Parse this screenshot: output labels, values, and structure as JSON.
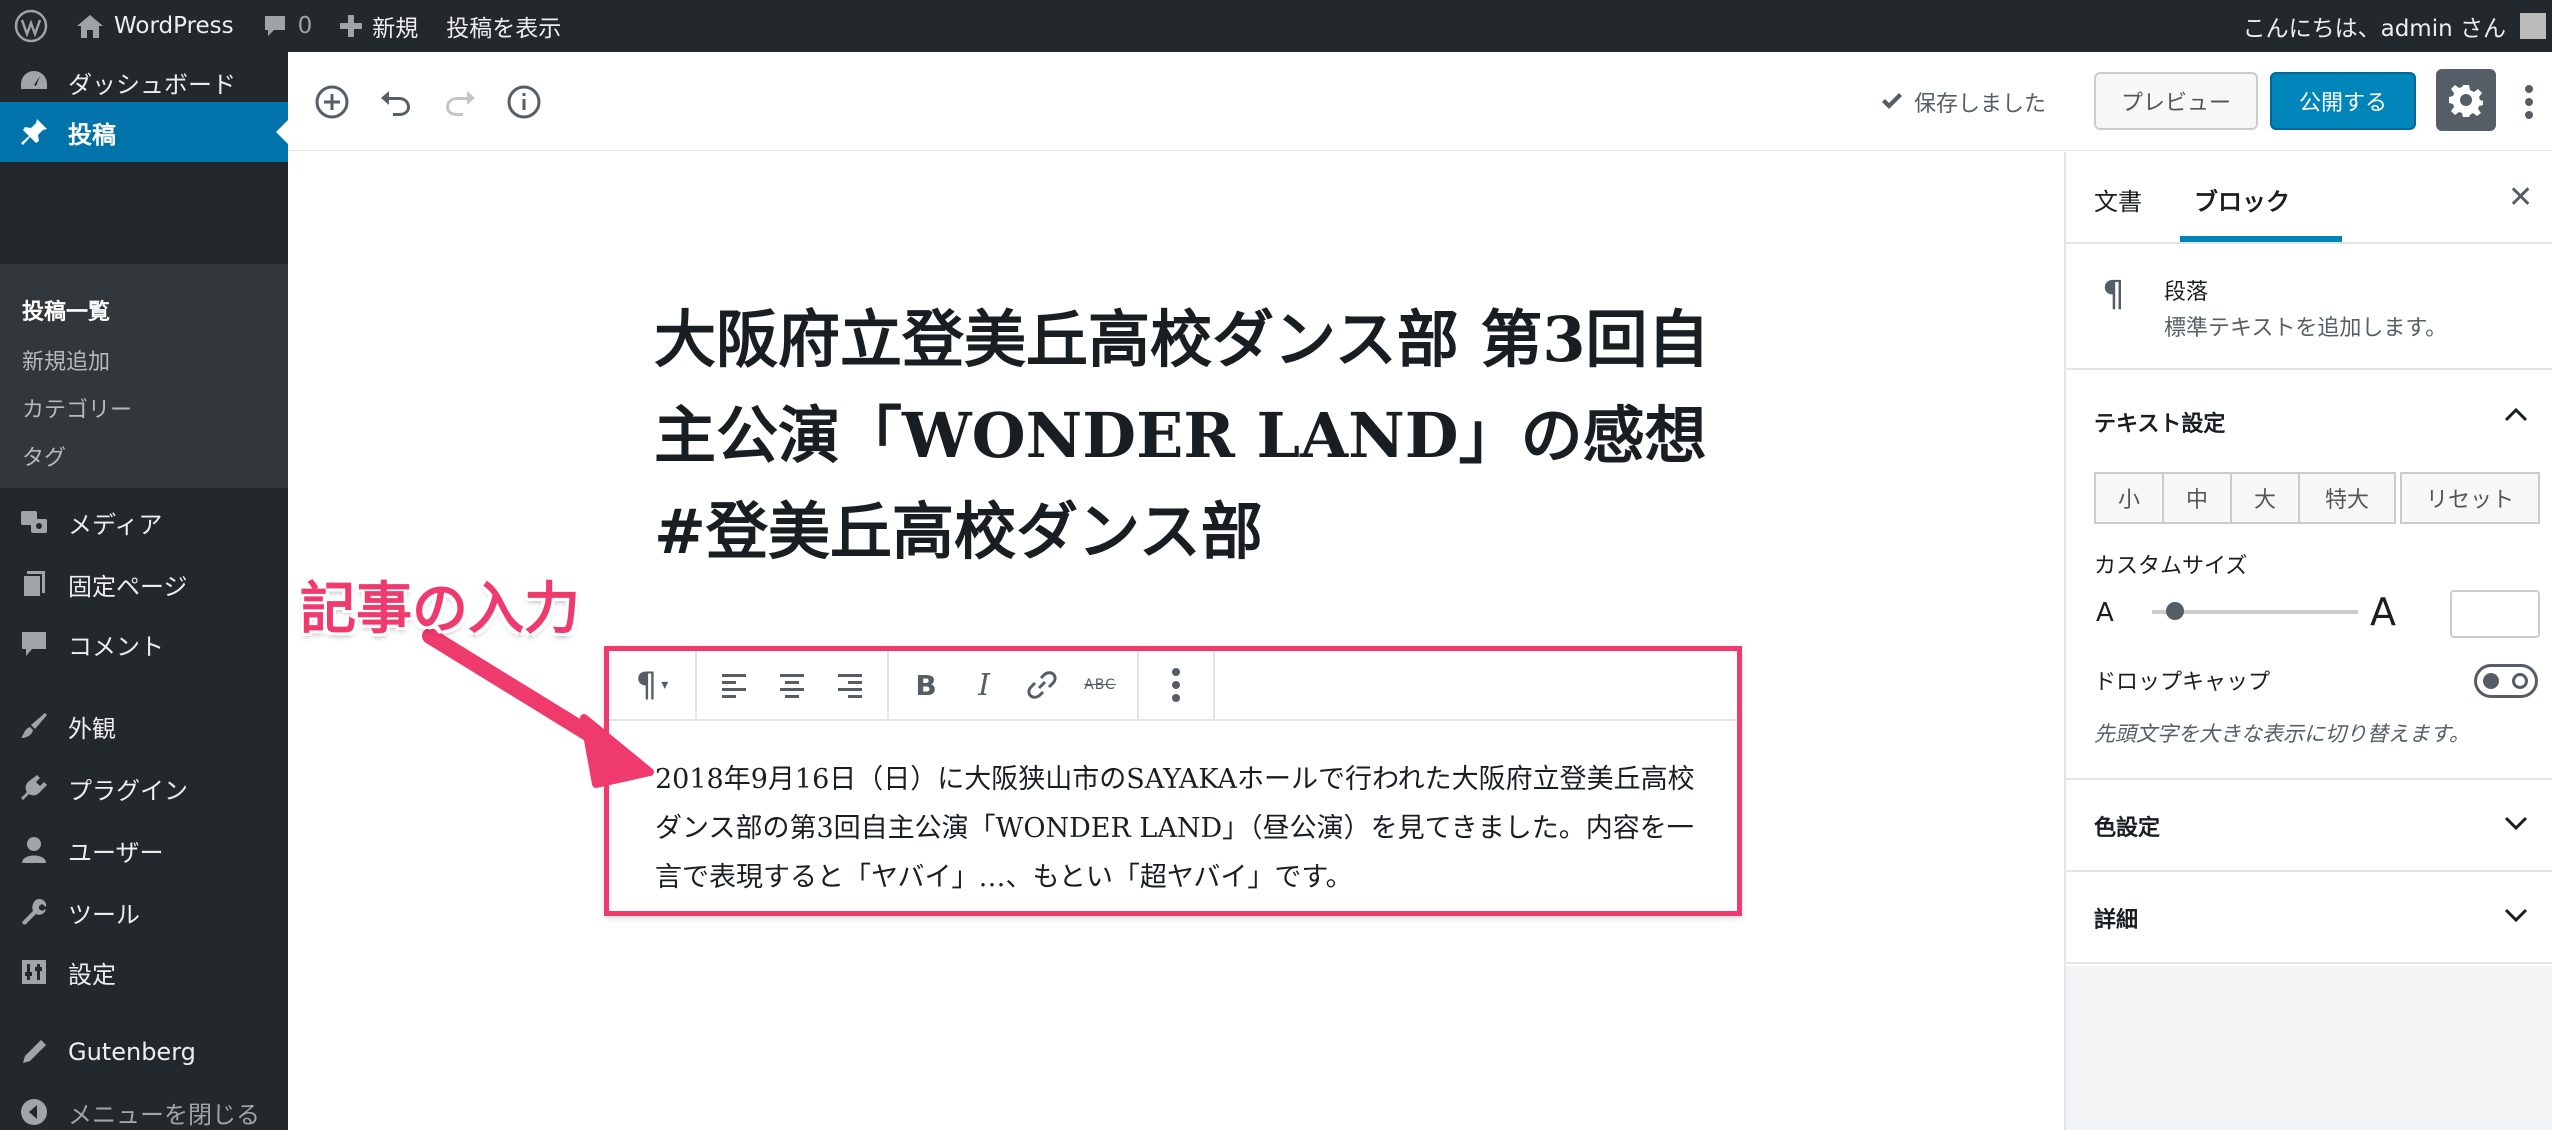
{
  "adminbar": {
    "site_name": "WordPress",
    "comments_count": "0",
    "new_label": "新規",
    "view_post_label": "投稿を表示",
    "greeting": "こんにちは、admin さん"
  },
  "sidebar": {
    "items": [
      {
        "label": "ダッシュボード",
        "icon": "dashboard-icon"
      },
      {
        "label": "投稿",
        "icon": "pin-icon",
        "current": true
      },
      {
        "label": "メディア",
        "icon": "media-icon"
      },
      {
        "label": "固定ページ",
        "icon": "page-icon"
      },
      {
        "label": "コメント",
        "icon": "comment-icon"
      },
      {
        "label": "外観",
        "icon": "brush-icon"
      },
      {
        "label": "プラグイン",
        "icon": "plugin-icon"
      },
      {
        "label": "ユーザー",
        "icon": "user-icon"
      },
      {
        "label": "ツール",
        "icon": "wrench-icon"
      },
      {
        "label": "設定",
        "icon": "settings-icon"
      },
      {
        "label": "Gutenberg",
        "icon": "pencil-icon"
      },
      {
        "label": "メニューを閉じる",
        "icon": "collapse-icon"
      }
    ],
    "submenu": [
      "投稿一覧",
      "新規追加",
      "カテゴリー",
      "タグ"
    ]
  },
  "header": {
    "saved_label": "保存しました",
    "preview_label": "プレビュー",
    "publish_label": "公開する"
  },
  "post": {
    "title": "大阪府立登美丘高校ダンス部 第3回自主公演「WONDER LAND」の感想 #登美丘高校ダンス部",
    "paragraph": "2018年9月16日（日）に大阪狭山市のSAYAKAホールで行われた大阪府立登美丘高校ダンス部の第3回自主公演「WONDER LAND」（昼公演）を見てきました。内容を一言で表現すると「ヤバイ」…、もとい「超ヤバイ」です。"
  },
  "toolbar": {
    "paragraph_symbol": "¶",
    "bold": "B",
    "italic": "I",
    "strikethrough": "ABC"
  },
  "annotation": "記事の入力",
  "settings": {
    "tab_document": "文書",
    "tab_block": "ブロック",
    "block_name": "段落",
    "block_description": "標準テキストを追加します。",
    "panel_text_settings": "テキスト設定",
    "font_sizes": [
      "小",
      "中",
      "大",
      "特大"
    ],
    "reset_label": "リセット",
    "custom_size_label": "カスタムサイズ",
    "slider_small": "A",
    "slider_large": "A",
    "dropcap_label": "ドロップキャップ",
    "dropcap_help": "先頭文字を大きな表示に切り替えます。",
    "panel_color": "色設定",
    "panel_advanced": "詳細"
  },
  "colors": {
    "accent": "#0085ba",
    "annotation": "#ef3a6d",
    "adminbar": "#23282d"
  }
}
